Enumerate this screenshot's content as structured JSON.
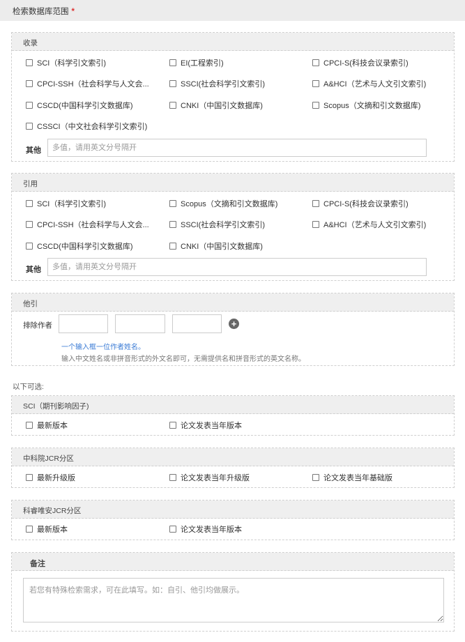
{
  "header": {
    "title": "检索数据库范围",
    "required_mark": "*"
  },
  "shoulu": {
    "title": "收录",
    "options": [
      "SCI（科学引文索引)",
      "EI(工程索引)",
      "CPCI-S(科技会议录索引)",
      "CPCI-SSH（社会科学与人文会...",
      "SSCI(社会科学引文索引)",
      "A&HCI（艺术与人文引文索引)",
      "CSCD(中国科学引文数据库)",
      "CNKI（中国引文数据库)",
      "Scopus（文摘和引文数据库)",
      "CSSCI（中文社会科学引文索引)"
    ],
    "other_label": "其他",
    "other_placeholder": "多值，请用英文分号隔开"
  },
  "yinyong": {
    "title": "引用",
    "options": [
      "SCI（科学引文索引)",
      "Scopus（文摘和引文数据库)",
      "CPCI-S(科技会议录索引)",
      "CPCI-SSH（社会科学与人文会...",
      "SSCI(社会科学引文索引)",
      "A&HCI（艺术与人文引文索引)",
      "CSCD(中国科学引文数据库)",
      "CNKI（中国引文数据库)"
    ],
    "other_label": "其他",
    "other_placeholder": "多值，请用英文分号隔开"
  },
  "tayin": {
    "title": "他引",
    "exclude_label": "排除作者",
    "add_symbol": "+",
    "hint_line1": "一个输入框一位作者姓名。",
    "hint_line2": "输入中文姓名或非拼音形式的外文名即可，无需提供名和拼音形式的英文名称。"
  },
  "optional_label": "以下可选:",
  "sci_if": {
    "title": "SCI（期刊影响因子)",
    "options": [
      "最新版本",
      "论文发表当年版本"
    ]
  },
  "cas_jcr": {
    "title": "中科院JCR分区",
    "options": [
      "最新升级版",
      "论文发表当年升级版",
      "论文发表当年基础版"
    ]
  },
  "clarivate_jcr": {
    "title": "科睿唯安JCR分区",
    "options": [
      "最新版本",
      "论文发表当年版本"
    ]
  },
  "remarks": {
    "title": "备注",
    "placeholder": "若您有特殊检索需求，可在此填写。如：自引、他引均做展示。"
  }
}
